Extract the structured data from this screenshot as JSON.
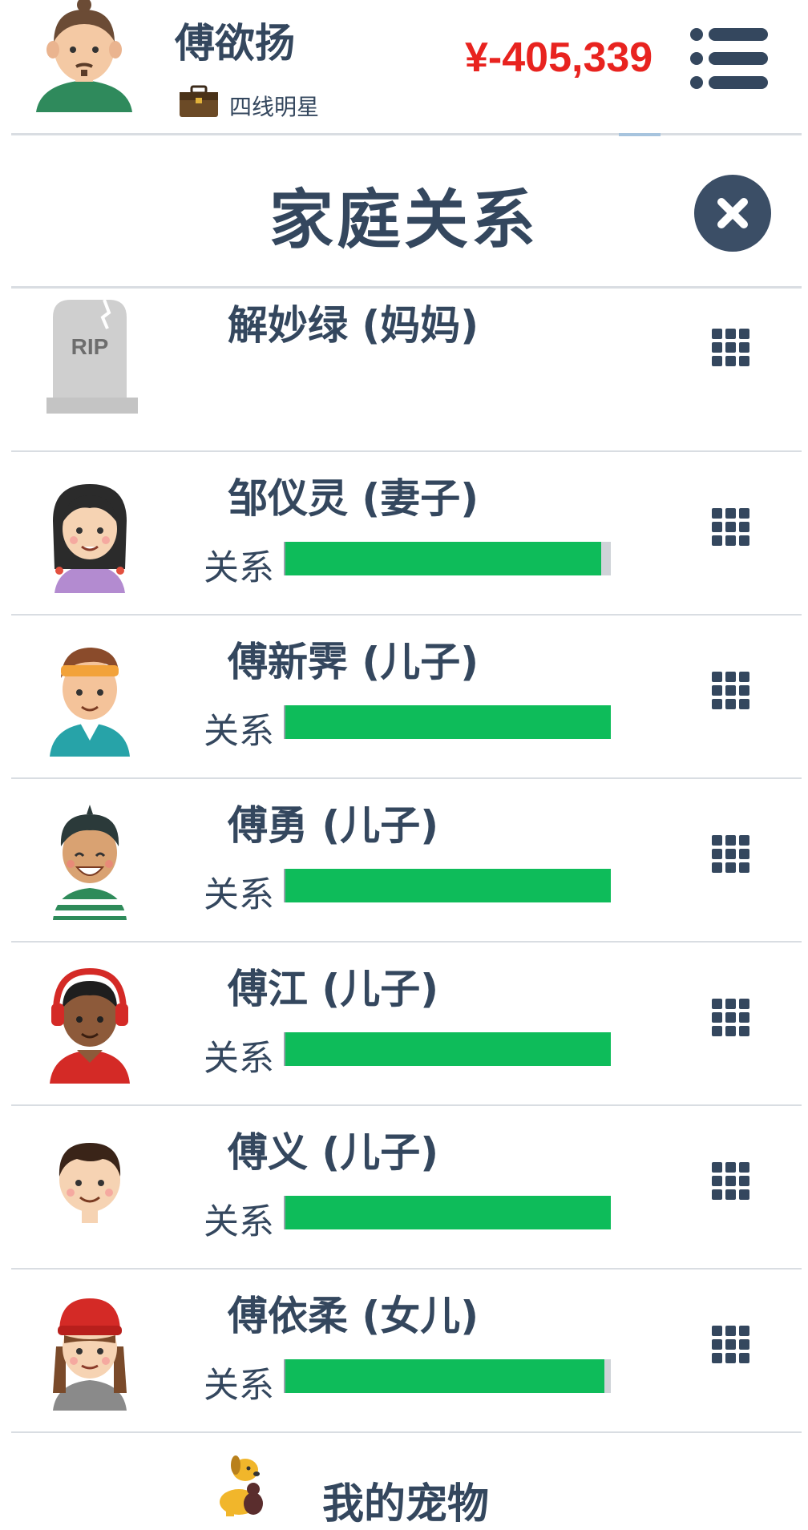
{
  "header": {
    "player_name": "傅欲扬",
    "job_label": "四线明星",
    "money": "¥-405,339",
    "menu_icon": "list-menu-icon",
    "colors": {
      "money": "#e8231f",
      "text": "#34475e"
    }
  },
  "modal": {
    "title": "家庭关系",
    "close_icon": "close-icon"
  },
  "relation_label": "关系",
  "family": [
    {
      "name": "解妙绿 (妈妈)",
      "deceased": true,
      "avatar": "rip-tombstone-icon",
      "relationship": null
    },
    {
      "name": "邹仪灵 (妻子)",
      "deceased": false,
      "avatar": "avatar-woman-braids",
      "relationship": 0.97
    },
    {
      "name": "傅新霁 (儿子)",
      "deceased": false,
      "avatar": "avatar-boy-headband",
      "relationship": 1.0
    },
    {
      "name": "傅勇 (儿子)",
      "deceased": false,
      "avatar": "avatar-boy-striped",
      "relationship": 1.0
    },
    {
      "name": "傅江 (儿子)",
      "deceased": false,
      "avatar": "avatar-boy-headphones",
      "relationship": 1.0
    },
    {
      "name": "傅义 (儿子)",
      "deceased": false,
      "avatar": "avatar-boy-child",
      "relationship": 1.0
    },
    {
      "name": "傅依柔 (女儿)",
      "deceased": false,
      "avatar": "avatar-girl-red-hat",
      "relationship": 0.98
    }
  ],
  "pet": {
    "label": "我的宠物",
    "icon": "dog-icon"
  },
  "bar_color": "#0ebc5a"
}
